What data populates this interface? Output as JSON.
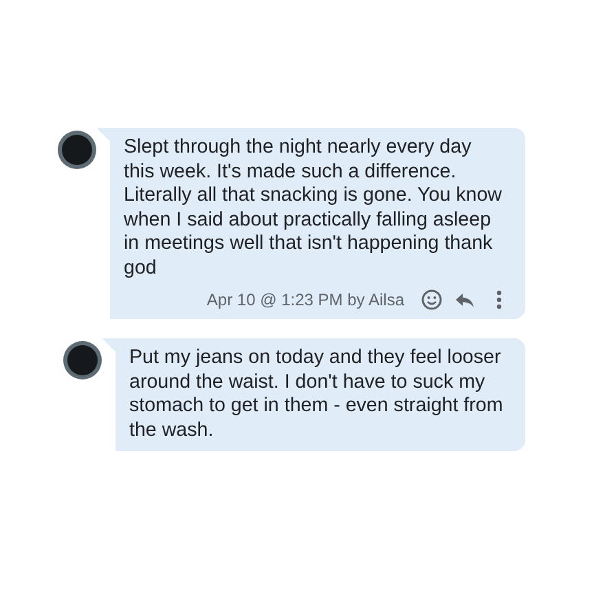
{
  "messages": [
    {
      "text": "Slept through the night nearly every day this week. It's made such a difference. Literally all that snacking is gone. You know when I said about practically falling asleep in meetings well that isn't happening thank god",
      "meta": "Apr 10 @ 1:23 PM by Ailsa"
    },
    {
      "text": "Put my jeans on today and they feel looser around the waist. I don't have to suck my stomach to get in them - even straight from the wash."
    }
  ]
}
